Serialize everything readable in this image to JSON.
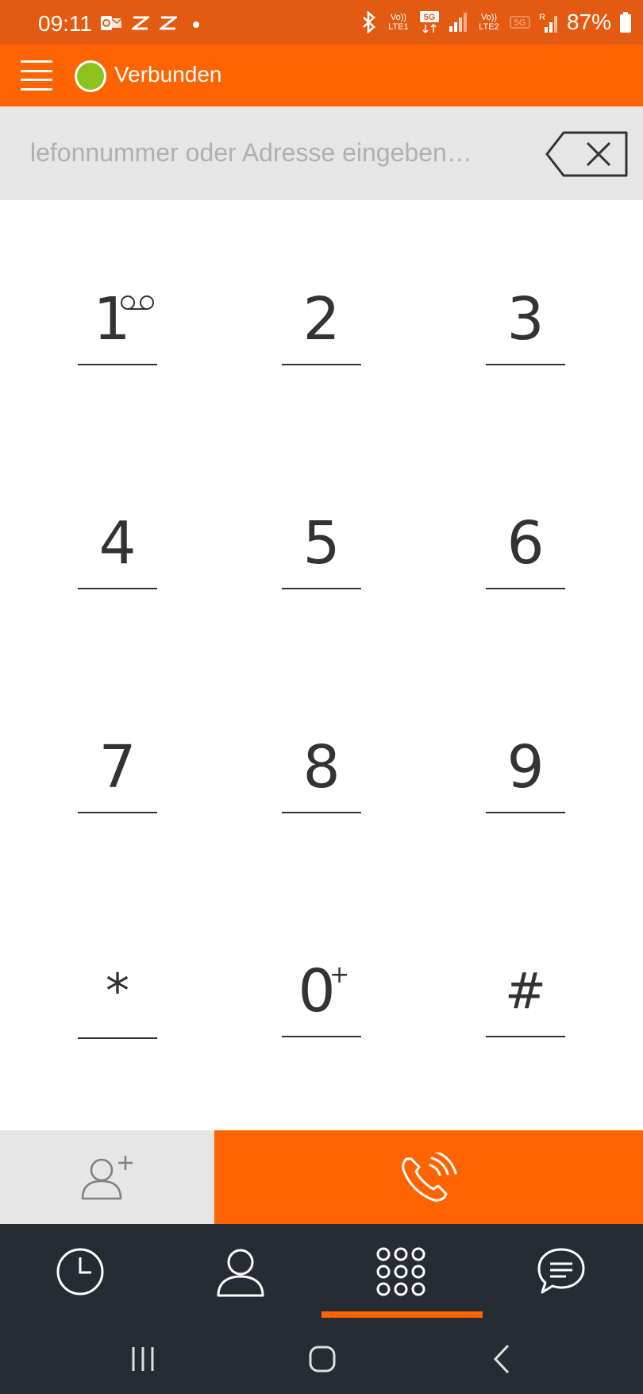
{
  "status_bar": {
    "time": "09:11",
    "notification_icons": [
      "outlook-icon",
      "zendesk-icon",
      "zendesk-icon",
      "dot-icon"
    ],
    "sim1_label": "Vo)) LTE1",
    "sim2_label": "Vo)) LTE2",
    "network_5g": "5G",
    "roaming": "R",
    "battery_percent": "87%"
  },
  "app_bar": {
    "connection_status": "Verbunden",
    "status_color": "#8cc11e"
  },
  "dial_input": {
    "placeholder": "…lefonnummer oder Adresse eingeben",
    "value": ""
  },
  "keypad": {
    "keys": [
      "1",
      "2",
      "3",
      "4",
      "5",
      "6",
      "7",
      "8",
      "9",
      "*",
      "0",
      "#"
    ],
    "zero_sub": "+"
  },
  "actions": {
    "add_contact_icon": "add-contact-icon",
    "call_icon": "call-icon"
  },
  "bottom_nav": {
    "items": [
      "history-icon",
      "contacts-icon",
      "dialpad-icon",
      "chat-icon"
    ],
    "active_index": 2
  },
  "colors": {
    "brand_orange": "#ff6400",
    "status_bar": "#e35a12",
    "nav_dark": "#262c33",
    "input_bg": "#e6e6e6"
  }
}
